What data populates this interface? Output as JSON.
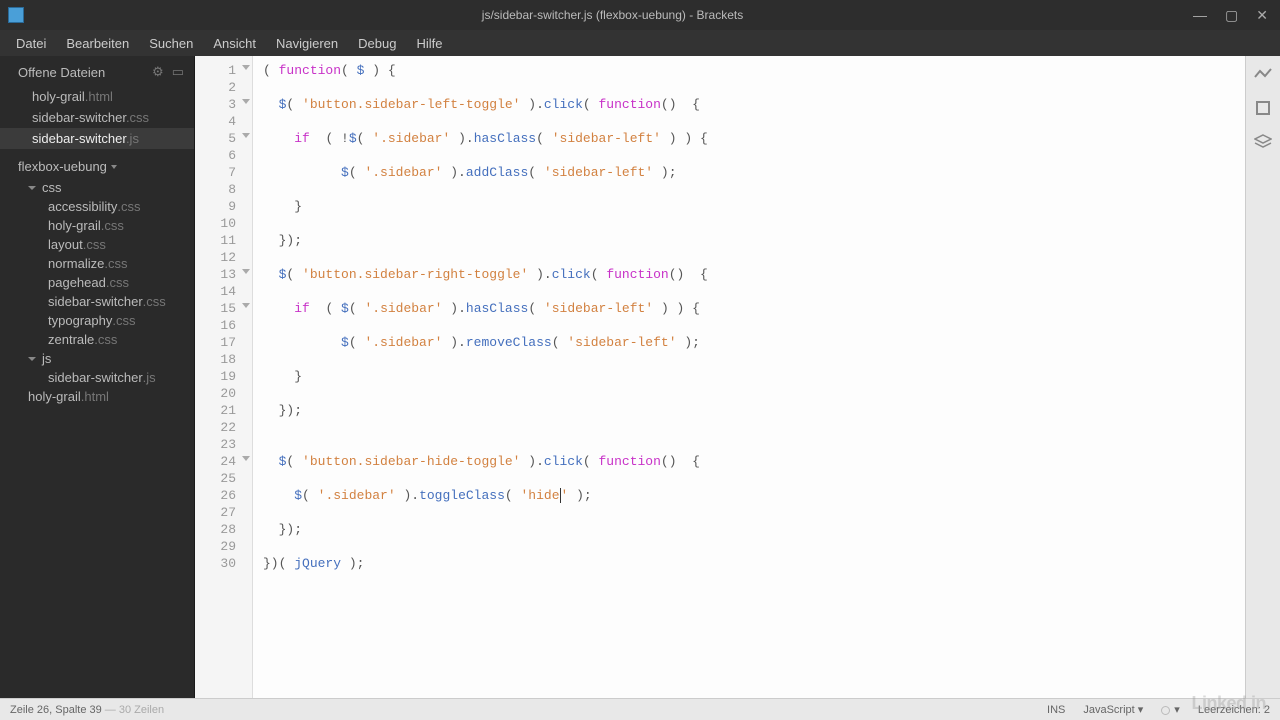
{
  "window": {
    "title": "js/sidebar-switcher.js (flexbox-uebung) - Brackets"
  },
  "menu": {
    "items": [
      "Datei",
      "Bearbeiten",
      "Suchen",
      "Ansicht",
      "Navigieren",
      "Debug",
      "Hilfe"
    ]
  },
  "sidebar": {
    "openFilesLabel": "Offene Dateien",
    "openFiles": [
      {
        "name": "holy-grail",
        "ext": ".html",
        "active": false
      },
      {
        "name": "sidebar-switcher",
        "ext": ".css",
        "active": false
      },
      {
        "name": "sidebar-switcher",
        "ext": ".js",
        "active": true
      }
    ],
    "project": "flexbox-uebung",
    "tree": {
      "cssFolder": "css",
      "cssFiles": [
        {
          "name": "accessibility",
          "ext": ".css"
        },
        {
          "name": "holy-grail",
          "ext": ".css"
        },
        {
          "name": "layout",
          "ext": ".css"
        },
        {
          "name": "normalize",
          "ext": ".css"
        },
        {
          "name": "pagehead",
          "ext": ".css"
        },
        {
          "name": "sidebar-switcher",
          "ext": ".css"
        },
        {
          "name": "typography",
          "ext": ".css"
        },
        {
          "name": "zentrale",
          "ext": ".css"
        }
      ],
      "jsFolder": "js",
      "jsFiles": [
        {
          "name": "sidebar-switcher",
          "ext": ".js"
        }
      ],
      "rootFiles": [
        {
          "name": "holy-grail",
          "ext": ".html"
        }
      ]
    }
  },
  "editor": {
    "lineCount": 30,
    "foldLines": [
      1,
      3,
      5,
      13,
      15,
      24
    ],
    "code": [
      [
        {
          "t": "paren",
          "v": "( "
        },
        {
          "t": "keyword",
          "v": "function"
        },
        {
          "t": "paren",
          "v": "( "
        },
        {
          "t": "var",
          "v": "$"
        },
        {
          "t": "paren",
          "v": " ) {"
        }
      ],
      [],
      [
        {
          "t": "plain",
          "v": "  "
        },
        {
          "t": "var",
          "v": "$"
        },
        {
          "t": "paren",
          "v": "( "
        },
        {
          "t": "string",
          "v": "'button.sidebar-left-toggle'"
        },
        {
          "t": "paren",
          "v": " )."
        },
        {
          "t": "var",
          "v": "click"
        },
        {
          "t": "paren",
          "v": "( "
        },
        {
          "t": "keyword",
          "v": "function"
        },
        {
          "t": "paren",
          "v": "()  {"
        }
      ],
      [],
      [
        {
          "t": "plain",
          "v": "    "
        },
        {
          "t": "keyword",
          "v": "if"
        },
        {
          "t": "plain",
          "v": "  "
        },
        {
          "t": "paren",
          "v": "( !"
        },
        {
          "t": "var",
          "v": "$"
        },
        {
          "t": "paren",
          "v": "( "
        },
        {
          "t": "string",
          "v": "'.sidebar'"
        },
        {
          "t": "paren",
          "v": " )."
        },
        {
          "t": "var",
          "v": "hasClass"
        },
        {
          "t": "paren",
          "v": "( "
        },
        {
          "t": "string",
          "v": "'sidebar-left'"
        },
        {
          "t": "paren",
          "v": " ) ) {"
        }
      ],
      [],
      [
        {
          "t": "plain",
          "v": "          "
        },
        {
          "t": "var",
          "v": "$"
        },
        {
          "t": "paren",
          "v": "( "
        },
        {
          "t": "string",
          "v": "'.sidebar'"
        },
        {
          "t": "paren",
          "v": " )."
        },
        {
          "t": "var",
          "v": "addClass"
        },
        {
          "t": "paren",
          "v": "( "
        },
        {
          "t": "string",
          "v": "'sidebar-left'"
        },
        {
          "t": "paren",
          "v": " );"
        }
      ],
      [],
      [
        {
          "t": "plain",
          "v": "    "
        },
        {
          "t": "paren",
          "v": "}"
        }
      ],
      [],
      [
        {
          "t": "plain",
          "v": "  "
        },
        {
          "t": "paren",
          "v": "});"
        }
      ],
      [],
      [
        {
          "t": "plain",
          "v": "  "
        },
        {
          "t": "var",
          "v": "$"
        },
        {
          "t": "paren",
          "v": "( "
        },
        {
          "t": "string",
          "v": "'button.sidebar-right-toggle'"
        },
        {
          "t": "paren",
          "v": " )."
        },
        {
          "t": "var",
          "v": "click"
        },
        {
          "t": "paren",
          "v": "( "
        },
        {
          "t": "keyword",
          "v": "function"
        },
        {
          "t": "paren",
          "v": "()  {"
        }
      ],
      [],
      [
        {
          "t": "plain",
          "v": "    "
        },
        {
          "t": "keyword",
          "v": "if"
        },
        {
          "t": "plain",
          "v": "  "
        },
        {
          "t": "paren",
          "v": "( "
        },
        {
          "t": "var",
          "v": "$"
        },
        {
          "t": "paren",
          "v": "( "
        },
        {
          "t": "string",
          "v": "'.sidebar'"
        },
        {
          "t": "paren",
          "v": " )."
        },
        {
          "t": "var",
          "v": "hasClass"
        },
        {
          "t": "paren",
          "v": "( "
        },
        {
          "t": "string",
          "v": "'sidebar-left'"
        },
        {
          "t": "paren",
          "v": " ) ) {"
        }
      ],
      [],
      [
        {
          "t": "plain",
          "v": "          "
        },
        {
          "t": "var",
          "v": "$"
        },
        {
          "t": "paren",
          "v": "( "
        },
        {
          "t": "string",
          "v": "'.sidebar'"
        },
        {
          "t": "paren",
          "v": " )."
        },
        {
          "t": "var",
          "v": "removeClass"
        },
        {
          "t": "paren",
          "v": "( "
        },
        {
          "t": "string",
          "v": "'sidebar-left'"
        },
        {
          "t": "paren",
          "v": " );"
        }
      ],
      [],
      [
        {
          "t": "plain",
          "v": "    "
        },
        {
          "t": "paren",
          "v": "}"
        }
      ],
      [],
      [
        {
          "t": "plain",
          "v": "  "
        },
        {
          "t": "paren",
          "v": "});"
        }
      ],
      [],
      [],
      [
        {
          "t": "plain",
          "v": "  "
        },
        {
          "t": "var",
          "v": "$"
        },
        {
          "t": "paren",
          "v": "( "
        },
        {
          "t": "string",
          "v": "'button.sidebar-hide-toggle'"
        },
        {
          "t": "paren",
          "v": " )."
        },
        {
          "t": "var",
          "v": "click"
        },
        {
          "t": "paren",
          "v": "( "
        },
        {
          "t": "keyword",
          "v": "function"
        },
        {
          "t": "paren",
          "v": "()  {"
        }
      ],
      [],
      [
        {
          "t": "plain",
          "v": "    "
        },
        {
          "t": "var",
          "v": "$"
        },
        {
          "t": "paren",
          "v": "( "
        },
        {
          "t": "string",
          "v": "'.sidebar'"
        },
        {
          "t": "paren",
          "v": " )."
        },
        {
          "t": "var",
          "v": "toggleClass"
        },
        {
          "t": "paren",
          "v": "( "
        },
        {
          "t": "string",
          "v": "'hide"
        },
        {
          "t": "cursor",
          "v": ""
        },
        {
          "t": "string",
          "v": "'"
        },
        {
          "t": "paren",
          "v": " );"
        }
      ],
      [],
      [
        {
          "t": "plain",
          "v": "  "
        },
        {
          "t": "paren",
          "v": "});"
        }
      ],
      [],
      [
        {
          "t": "paren",
          "v": "})( "
        },
        {
          "t": "var",
          "v": "jQuery"
        },
        {
          "t": "paren",
          "v": " );"
        }
      ]
    ]
  },
  "status": {
    "cursor": "Zeile 26, Spalte 39",
    "total": "30 Zeilen",
    "insert": "INS",
    "language": "JavaScript",
    "spaces": "Leerzeichen: 2"
  },
  "watermark": "Linked in"
}
